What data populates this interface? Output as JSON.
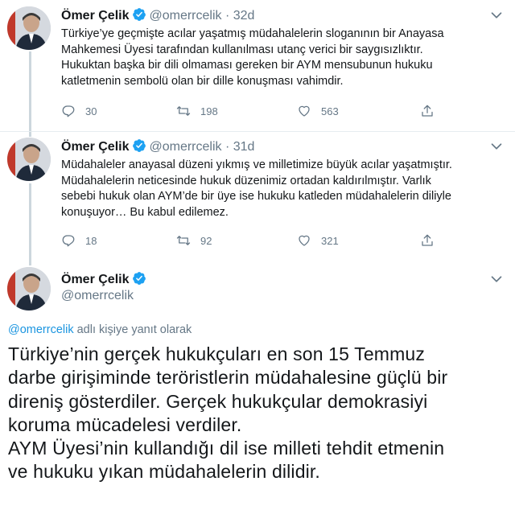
{
  "tweets": [
    {
      "name": "Ömer Çelik",
      "handle": "@omerrcelik",
      "dot": "·",
      "time": "32d",
      "lines": [
        "Türkiye’ye geçmişte acılar yaşatmış müdahalelerin sloganının bir Anayasa",
        "Mahkemesi Üyesi tarafından kullanılması utanç verici bir saygısızlıktır.",
        "Hukuktan başka bir dili olmaması gereken bir AYM mensubunun hukuku",
        "katletmenin sembolü olan bir dille konuşması vahimdir."
      ],
      "replies": "30",
      "retweets": "198",
      "likes": "563"
    },
    {
      "name": "Ömer Çelik",
      "handle": "@omerrcelik",
      "dot": "·",
      "time": "31d",
      "lines": [
        "Müdahaleler anayasal düzeni yıkmış ve milletimize büyük acılar yaşatmıştır.",
        "Müdahalelerin neticesinde hukuk düzenimiz ortadan kaldırılmıştır. Varlık",
        "sebebi hukuk olan AYM’de bir üye ise hukuku katleden müdahalelerin diliyle",
        "konuşuyor… Bu kabul edilemez."
      ],
      "replies": "18",
      "retweets": "92",
      "likes": "321"
    }
  ],
  "main_tweet": {
    "name": "Ömer Çelik",
    "handle": "@omerrcelik",
    "reply_mention": "@omerrcelik",
    "reply_suffix": " adlı kişiye yanıt olarak",
    "lines": [
      "Türkiye’nin gerçek hukukçuları en son 15 Temmuz",
      "darbe girişiminde teröristlerin müdahalesine güçlü bir",
      "direniş gösterdiler. Gerçek hukukçular demokrasiyi",
      "koruma mücadelesi verdiler.",
      "AYM Üyesi’nin kullandığı dil ise milleti tehdit etmenin",
      "ve hukuku yıkan müdahalelerin dilidir."
    ]
  },
  "icons": {
    "verified": "verified-badge-icon",
    "reply": "reply-icon",
    "retweet": "retweet-icon",
    "like": "heart-icon",
    "share": "share-icon",
    "more": "chevron-down-icon"
  },
  "colors": {
    "verified": "#1da1f2",
    "text": "#14171a",
    "secondary": "#657786",
    "link": "#1b95e0",
    "thread": "#ccd6dd"
  }
}
